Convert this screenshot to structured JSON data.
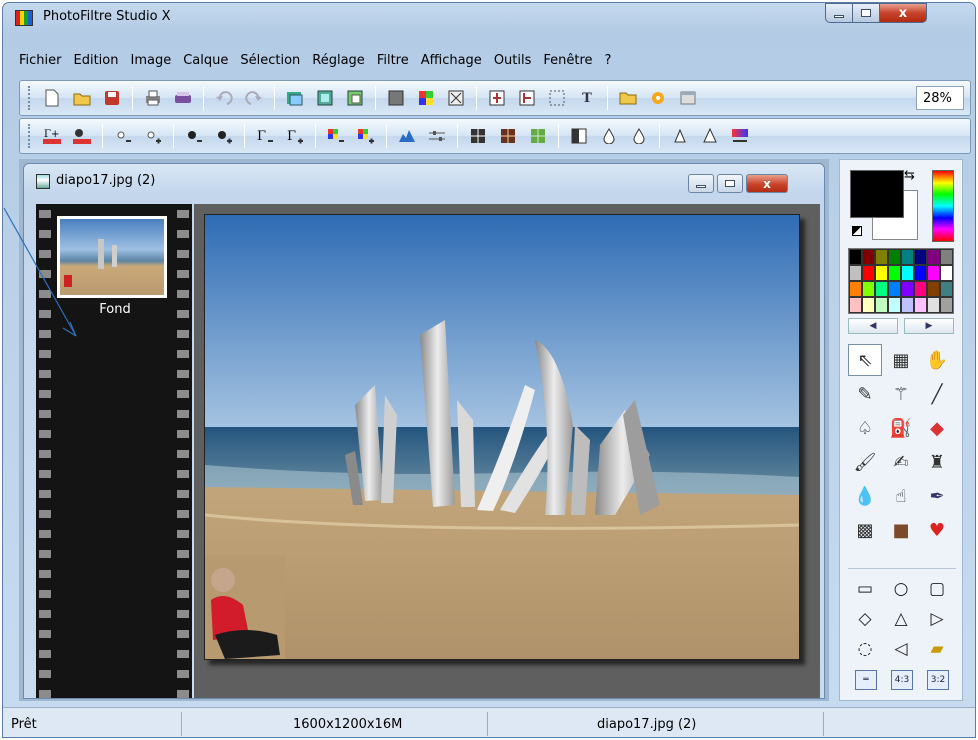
{
  "window": {
    "title": "PhotoFiltre Studio X",
    "close_glyph": "x"
  },
  "menu": [
    "Fichier",
    "Edition",
    "Image",
    "Calque",
    "Sélection",
    "Réglage",
    "Filtre",
    "Affichage",
    "Outils",
    "Fenêtre",
    "?"
  ],
  "toolbar": {
    "zoom": "28%",
    "text_tool_glyph": "T"
  },
  "document": {
    "title": "diapo17.jpg (2)",
    "layer_name": "Fond"
  },
  "status": {
    "state": "Prêt",
    "image_info": "1600x1200x16M",
    "file": "diapo17.jpg (2)"
  },
  "ratio_buttons": [
    "4:3",
    "3:2"
  ],
  "colors": {
    "accent": "#2f6fb4",
    "fg": "#000000",
    "bg": "#ffffff"
  }
}
